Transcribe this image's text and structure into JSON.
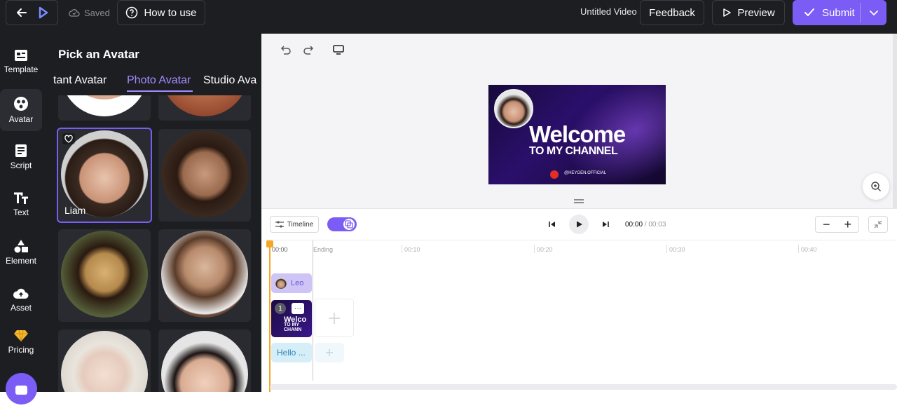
{
  "topbar": {
    "saved_label": "Saved",
    "how_to_use_label": "How to use",
    "video_title": "Untitled Video",
    "feedback_label": "Feedback",
    "preview_label": "Preview",
    "submit_label": "Submit"
  },
  "rail": {
    "items": [
      {
        "label": "Template",
        "icon": "template-icon"
      },
      {
        "label": "Avatar",
        "icon": "avatar-icon"
      },
      {
        "label": "Script",
        "icon": "script-icon"
      },
      {
        "label": "Text",
        "icon": "text-icon"
      },
      {
        "label": "Element",
        "icon": "element-icon"
      },
      {
        "label": "Asset",
        "icon": "asset-icon"
      },
      {
        "label": "Pricing",
        "icon": "diamond-icon"
      }
    ]
  },
  "panel": {
    "title": "Pick an Avatar",
    "tabs": [
      {
        "label": "tant Avatar"
      },
      {
        "label": "Photo Avatar",
        "active": true
      },
      {
        "label": "Studio Ava"
      }
    ],
    "selected_avatar_name": "Liam"
  },
  "video": {
    "headline": "Welcome",
    "subline": "TO MY CHANNEL",
    "handle": "@HEYGEN.OFFICIAL"
  },
  "timeline_bar": {
    "timeline_label": "Timeline",
    "current_time": "00:00",
    "total_time": "/ 00:03",
    "minus": "−",
    "plus": "+"
  },
  "timeline": {
    "ticks": [
      "00:00",
      "Ending",
      "00:10",
      "00:20",
      "00:30",
      "00:40"
    ],
    "avatar_clip_label": "Leo",
    "scene_number": "1",
    "scene_more": "···",
    "scene_text_1": "Welco",
    "scene_text_2": "TO MY CHANN",
    "text_clip_label": "Hello ..."
  },
  "colors": {
    "accent": "#7b5cf5",
    "topbar_bg": "#1d1e22",
    "playhead": "#f5a623"
  }
}
